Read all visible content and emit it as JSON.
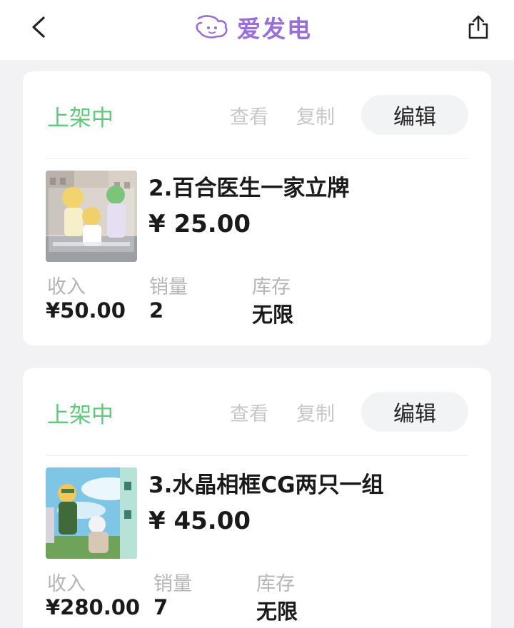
{
  "header": {
    "title": "爱发电",
    "back_icon": "chevron-left-icon",
    "share_icon": "share-upload-icon",
    "brand_color": "#9b6fd8"
  },
  "products": [
    {
      "status": "上架中",
      "view_label": "查看",
      "copy_label": "复制",
      "edit_label": "编辑",
      "title": "2.百合医生一家立牌",
      "price": "¥ 25.00",
      "stats": {
        "income_label": "收入",
        "income_value": "¥50.00",
        "sales_label": "销量",
        "sales_value": "2",
        "stock_label": "库存",
        "stock_value": "无限"
      }
    },
    {
      "status": "上架中",
      "view_label": "查看",
      "copy_label": "复制",
      "edit_label": "编辑",
      "title": "3.水晶相框CG两只一组",
      "price": "¥ 45.00",
      "stats": {
        "income_label": "收入",
        "income_value": "¥280.00",
        "sales_label": "销量",
        "sales_value": "7",
        "stock_label": "库存",
        "stock_value": "无限"
      }
    }
  ],
  "colors": {
    "status_green": "#5ecb7c",
    "muted_action": "#c8c8cc",
    "page_background": "#f2f2f4"
  }
}
